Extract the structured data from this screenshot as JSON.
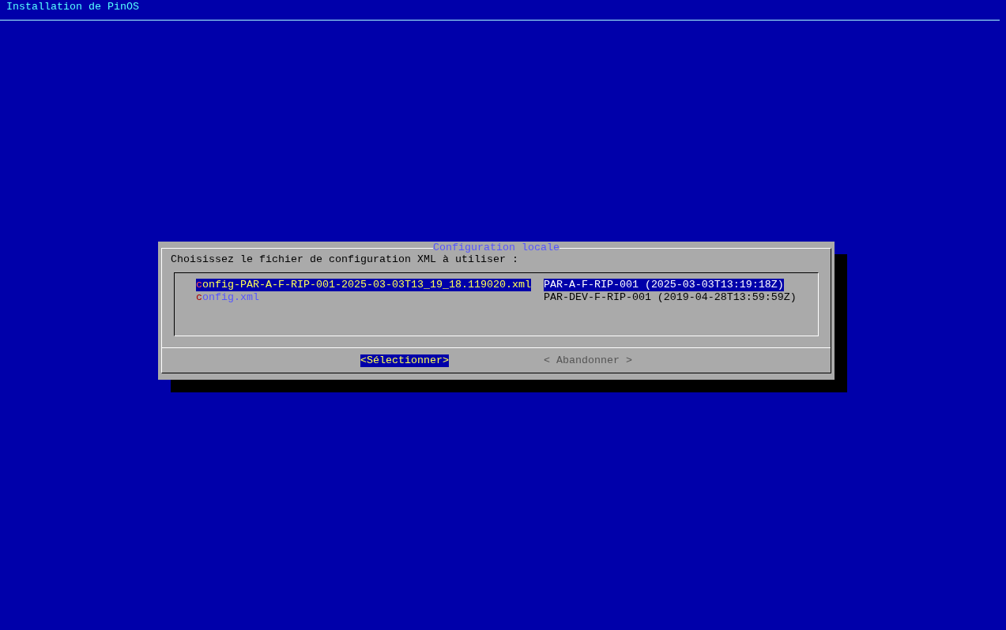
{
  "header": {
    "title": "Installation de PinOS"
  },
  "dialog": {
    "title": "Configuration locale",
    "prompt": "Choisissez le fichier de configuration XML à utiliser :",
    "items": [
      {
        "tag": "config-PAR-A-F-RIP-001-2025-03-03T13_19_18.119020.xml",
        "description": "PAR-A-F-RIP-001 (2025-03-03T13:19:18Z)",
        "selected": true
      },
      {
        "tag": "config.xml",
        "description": "PAR-DEV-F-RIP-001 (2019-04-28T13:59:59Z)",
        "selected": false
      }
    ],
    "buttons": [
      {
        "label": "<Sélectionner>",
        "selected": true
      },
      {
        "label": "< Abandonner >",
        "selected": false
      }
    ]
  }
}
